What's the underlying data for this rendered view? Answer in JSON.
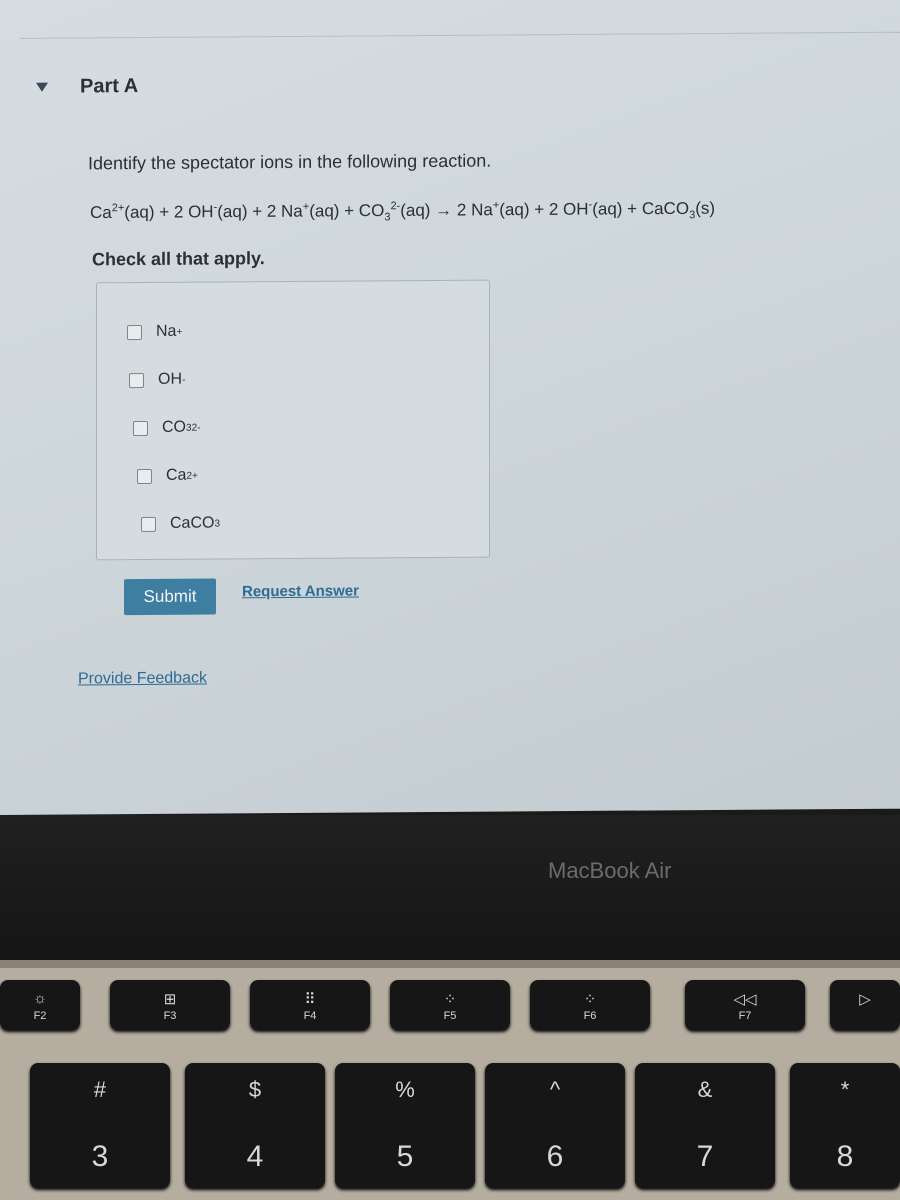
{
  "part": {
    "title": "Part A",
    "expanded": true
  },
  "question": "Identify the spectator ions in the following reaction.",
  "equation": [
    {
      "t": "Ca"
    },
    {
      "sup": "2+"
    },
    {
      "t": "(aq) + 2 OH"
    },
    {
      "sup": "-"
    },
    {
      "t": "(aq) + 2 Na"
    },
    {
      "sup": "+"
    },
    {
      "t": "(aq) + CO"
    },
    {
      "sub": "3"
    },
    {
      "sup": "2-"
    },
    {
      "t": "(aq) → 2 Na"
    },
    {
      "sup": "+"
    },
    {
      "t": "(aq) + 2 OH"
    },
    {
      "sup": "-"
    },
    {
      "t": "(aq) + CaCO"
    },
    {
      "sub": "3"
    },
    {
      "t": "(s)"
    }
  ],
  "instruction": "Check all that apply.",
  "options": [
    {
      "base": "Na",
      "sub": "",
      "sup": "+",
      "checked": false
    },
    {
      "base": "OH",
      "sub": "",
      "sup": "-",
      "checked": false
    },
    {
      "base": "CO",
      "sub": "3",
      "sup": "2-",
      "checked": false
    },
    {
      "base": "Ca",
      "sub": "",
      "sup": "2+",
      "checked": false
    },
    {
      "base": "CaCO",
      "sub": "3",
      "sup": "",
      "checked": false
    }
  ],
  "buttons": {
    "submit": "Submit",
    "request_answer": "Request Answer",
    "provide_feedback": "Provide Feedback"
  },
  "laptop": {
    "brand": "MacBook Air"
  },
  "fkeys": [
    {
      "icon": "☼",
      "label": "F2"
    },
    {
      "icon": "⊞",
      "label": "F3"
    },
    {
      "icon": "⠿",
      "label": "F4"
    },
    {
      "icon": "⁘",
      "label": "F5"
    },
    {
      "icon": "⁘",
      "label": "F6"
    },
    {
      "icon": "◁◁",
      "label": "F7"
    },
    {
      "icon": "▷",
      "label": ""
    }
  ],
  "numkeys": [
    {
      "top": "#",
      "bottom": "3"
    },
    {
      "top": "$",
      "bottom": "4"
    },
    {
      "top": "%",
      "bottom": "5"
    },
    {
      "top": "^",
      "bottom": "6"
    },
    {
      "top": "&",
      "bottom": "7"
    },
    {
      "top": "*",
      "bottom": "8"
    }
  ],
  "colors": {
    "submit": "#3d7ea1",
    "link": "#2f6b93"
  }
}
